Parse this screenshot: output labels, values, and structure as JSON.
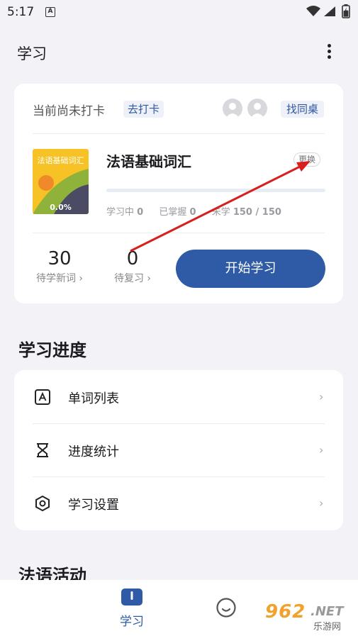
{
  "status_bar": {
    "time": "5:17",
    "notification_icon": "A"
  },
  "app_bar": {
    "title": "学习"
  },
  "study_card": {
    "checkin_status": "当前尚未打卡",
    "checkin_button": "去打卡",
    "find_deskmate_button": "找同桌",
    "book": {
      "cover_title": "法语基础词汇",
      "cover_progress": "0.0%",
      "title": "法语基础词汇",
      "change_button": "更换",
      "progress": 0,
      "stats": {
        "learning_label": "学习中",
        "learning_value": "0",
        "mastered_label": "已掌握",
        "mastered_value": "0",
        "unlearned_label": "未学",
        "unlearned_value": "150 / 150"
      }
    },
    "new_words": {
      "count": "30",
      "label": "待学新词 ›"
    },
    "review": {
      "count": "0",
      "label": "待复习 ›"
    },
    "start_button": "开始学习"
  },
  "progress_section": {
    "heading": "学习进度",
    "items": [
      {
        "label": "单词列表",
        "icon": "word-list-icon"
      },
      {
        "label": "进度统计",
        "icon": "hourglass-icon"
      },
      {
        "label": "学习设置",
        "icon": "settings-hexagon-icon"
      }
    ]
  },
  "activity_section": {
    "heading": "法语活动"
  },
  "bottom_nav": {
    "study_label": "学习",
    "watermark_num": "962",
    "watermark_net": ".NET",
    "watermark_cn": "乐游网"
  },
  "colors": {
    "accent": "#2f5aa5",
    "annotation_arrow": "#d81e1e",
    "cover": "#f6c225"
  }
}
